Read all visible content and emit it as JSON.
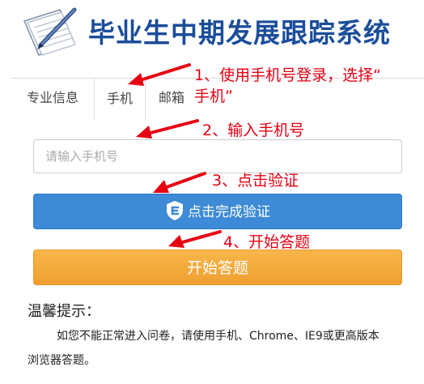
{
  "header": {
    "title": "毕业生中期发展跟踪系统"
  },
  "tabs": [
    {
      "label": "专业信息"
    },
    {
      "label": "手机"
    },
    {
      "label": "邮箱"
    }
  ],
  "phone_input": {
    "placeholder": "请输入手机号",
    "value": ""
  },
  "verify_button": {
    "label": "点击完成验证"
  },
  "start_button": {
    "label": "开始答题"
  },
  "annotations": {
    "step1_line1": "1、使用手机号登录，选择“",
    "step1_line2": "手机”",
    "step2": "2、输入手机号",
    "step3": "3、点击验证",
    "step4": "4、开始答题"
  },
  "tips": {
    "title": "温馨提示：",
    "line1": "如您不能正常进入问卷，请使用手机、Chrome、IE9或更高版本",
    "line2": "浏览器答题。"
  },
  "colors": {
    "title_blue": "#1b4d9a",
    "verify_blue": "#3d8ad6",
    "start_orange": "#f0a535",
    "annotation_red": "#e60012"
  }
}
